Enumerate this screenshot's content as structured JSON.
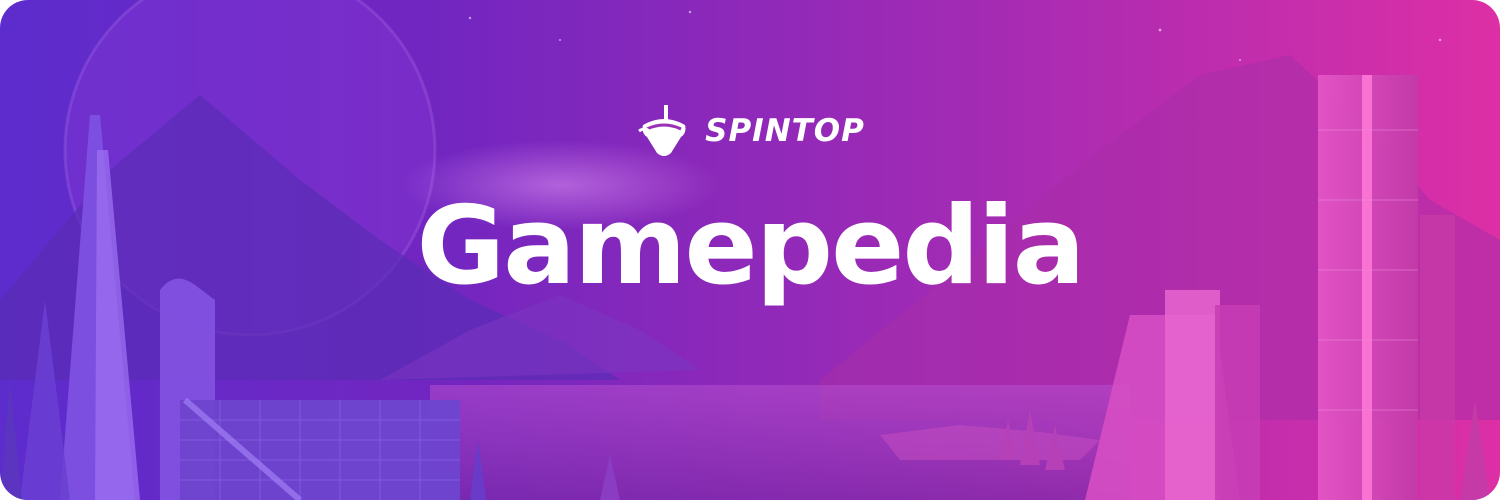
{
  "brand": {
    "name": "SPINTOP",
    "logo_icon": "spinning-top-icon"
  },
  "banner": {
    "title": "Gamepedia"
  },
  "colors": {
    "gradient_left": "#5d2ccd",
    "gradient_mid": "#a32bb4",
    "gradient_right": "#dd2fa6",
    "text": "#ffffff"
  }
}
